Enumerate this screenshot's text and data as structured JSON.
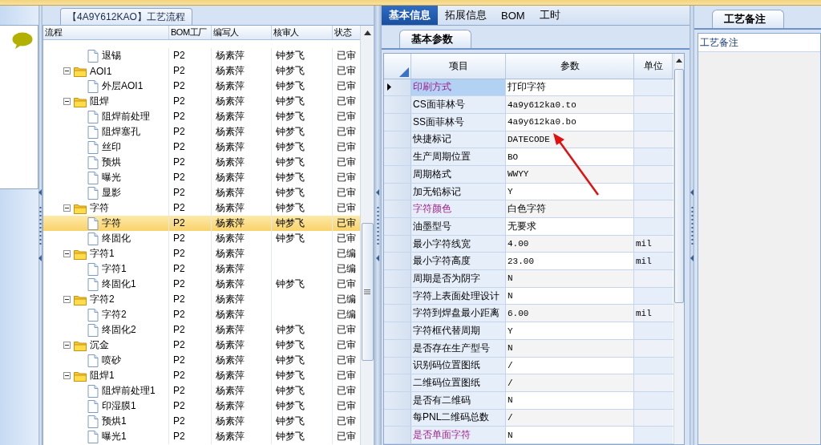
{
  "process_panel": {
    "title": "【4A9Y612KAO】工艺流程",
    "columns": [
      "流程",
      "BOM工厂",
      "编写人",
      "核审人",
      "状态"
    ],
    "tree": [
      {
        "kind": "step",
        "name": "退锡",
        "bom": "P2",
        "writer": "杨素萍",
        "reviewer": "钟梦飞",
        "status": "已审",
        "selected": false
      },
      {
        "kind": "folder",
        "name": "AOI1",
        "bom": "P2",
        "writer": "杨素萍",
        "reviewer": "钟梦飞",
        "status": "已审",
        "selected": false,
        "expanded": true,
        "children": [
          {
            "kind": "step",
            "name": "外层AOI1",
            "bom": "P2",
            "writer": "杨素萍",
            "reviewer": "钟梦飞",
            "status": "已审",
            "selected": false
          }
        ]
      },
      {
        "kind": "folder",
        "name": "阻焊",
        "bom": "P2",
        "writer": "杨素萍",
        "reviewer": "钟梦飞",
        "status": "已审",
        "selected": false,
        "expanded": true,
        "children": [
          {
            "kind": "step",
            "name": "阻焊前处理",
            "bom": "P2",
            "writer": "杨素萍",
            "reviewer": "钟梦飞",
            "status": "已审",
            "selected": false
          },
          {
            "kind": "step",
            "name": "阻焊塞孔",
            "bom": "P2",
            "writer": "杨素萍",
            "reviewer": "钟梦飞",
            "status": "已审",
            "selected": false
          },
          {
            "kind": "step",
            "name": "丝印",
            "bom": "P2",
            "writer": "杨素萍",
            "reviewer": "钟梦飞",
            "status": "已审",
            "selected": false
          },
          {
            "kind": "step",
            "name": "预烘",
            "bom": "P2",
            "writer": "杨素萍",
            "reviewer": "钟梦飞",
            "status": "已审",
            "selected": false
          },
          {
            "kind": "step",
            "name": "曝光",
            "bom": "P2",
            "writer": "杨素萍",
            "reviewer": "钟梦飞",
            "status": "已审",
            "selected": false
          },
          {
            "kind": "step",
            "name": "显影",
            "bom": "P2",
            "writer": "杨素萍",
            "reviewer": "钟梦飞",
            "status": "已审",
            "selected": false
          }
        ]
      },
      {
        "kind": "folder",
        "name": "字符",
        "bom": "P2",
        "writer": "杨素萍",
        "reviewer": "钟梦飞",
        "status": "已审",
        "selected": false,
        "expanded": true,
        "children": [
          {
            "kind": "step",
            "name": "字符",
            "bom": "P2",
            "writer": "杨素萍",
            "reviewer": "钟梦飞",
            "status": "已审",
            "selected": true
          },
          {
            "kind": "step",
            "name": "终固化",
            "bom": "P2",
            "writer": "杨素萍",
            "reviewer": "钟梦飞",
            "status": "已审",
            "selected": false
          }
        ]
      },
      {
        "kind": "folder",
        "name": "字符1",
        "bom": "P2",
        "writer": "杨素萍",
        "status": "已编",
        "selected": false,
        "expanded": true,
        "children": [
          {
            "kind": "step",
            "name": "字符1",
            "bom": "P2",
            "writer": "杨素萍",
            "status": "已编",
            "selected": false
          },
          {
            "kind": "step",
            "name": "终固化1",
            "bom": "P2",
            "writer": "杨素萍",
            "reviewer": "钟梦飞",
            "status": "已审",
            "selected": false
          }
        ]
      },
      {
        "kind": "folder",
        "name": "字符2",
        "bom": "P2",
        "writer": "杨素萍",
        "status": "已编",
        "selected": false,
        "expanded": true,
        "children": [
          {
            "kind": "step",
            "name": "字符2",
            "bom": "P2",
            "writer": "杨素萍",
            "status": "已编",
            "selected": false
          },
          {
            "kind": "step",
            "name": "终固化2",
            "bom": "P2",
            "writer": "杨素萍",
            "reviewer": "钟梦飞",
            "status": "已审",
            "selected": false
          }
        ]
      },
      {
        "kind": "folder",
        "name": "沉金",
        "bom": "P2",
        "writer": "杨素萍",
        "reviewer": "钟梦飞",
        "status": "已审",
        "selected": false,
        "expanded": true,
        "children": [
          {
            "kind": "step",
            "name": "喷砂",
            "bom": "P2",
            "writer": "杨素萍",
            "reviewer": "钟梦飞",
            "status": "已审",
            "selected": false
          }
        ]
      },
      {
        "kind": "folder",
        "name": "阻焊1",
        "bom": "P2",
        "writer": "杨素萍",
        "reviewer": "钟梦飞",
        "status": "已审",
        "selected": false,
        "expanded": true,
        "children": [
          {
            "kind": "step",
            "name": "阻焊前处理1",
            "bom": "P2",
            "writer": "杨素萍",
            "reviewer": "钟梦飞",
            "status": "已审",
            "selected": false
          },
          {
            "kind": "step",
            "name": "印湿膜1",
            "bom": "P2",
            "writer": "杨素萍",
            "reviewer": "钟梦飞",
            "status": "已审",
            "selected": false
          },
          {
            "kind": "step",
            "name": "预烘1",
            "bom": "P2",
            "writer": "杨素萍",
            "reviewer": "钟梦飞",
            "status": "已审",
            "selected": false
          },
          {
            "kind": "step",
            "name": "曝光1",
            "bom": "P2",
            "writer": "杨素萍",
            "reviewer": "钟梦飞",
            "status": "已审",
            "selected": false
          }
        ]
      }
    ]
  },
  "detail_panel": {
    "tabs": [
      {
        "label": "基本信息",
        "selected": true
      },
      {
        "label": "拓展信息",
        "selected": false
      },
      {
        "label": "BOM",
        "selected": false
      },
      {
        "label": "工时",
        "selected": false
      }
    ],
    "subtab": "基本参数",
    "columns": [
      "项目",
      "参数",
      "单位"
    ],
    "rows": [
      {
        "item": "印刷方式",
        "value": "打印字符",
        "emphasis": true,
        "selected": true
      },
      {
        "item": "CS面菲林号",
        "value": "4a9y612ka0.to",
        "emphasis": false,
        "selected": false
      },
      {
        "item": "SS面菲林号",
        "value": "4a9y612ka0.bo",
        "emphasis": false,
        "selected": false
      },
      {
        "item": "快捷标记",
        "value": "DATECODE",
        "emphasis": false,
        "selected": false
      },
      {
        "item": "生产周期位置",
        "value": "BO",
        "emphasis": false,
        "selected": false
      },
      {
        "item": "周期格式",
        "value": "WWYY",
        "emphasis": false,
        "selected": false
      },
      {
        "item": "加无铅标记",
        "value": "Y",
        "emphasis": false,
        "selected": false
      },
      {
        "item": "字符颜色",
        "value": "白色字符",
        "emphasis": true,
        "selected": false
      },
      {
        "item": "油墨型号",
        "value": "无要求",
        "emphasis": false,
        "selected": false
      },
      {
        "item": "最小字符线宽",
        "value": "4.00",
        "unit": "mil",
        "emphasis": false,
        "selected": false
      },
      {
        "item": "最小字符高度",
        "value": "23.00",
        "unit": "mil",
        "emphasis": false,
        "selected": false
      },
      {
        "item": "周期是否为阴字",
        "value": "N",
        "emphasis": false,
        "selected": false
      },
      {
        "item": "字符上表面处理设计",
        "value": "N",
        "emphasis": false,
        "selected": false
      },
      {
        "item": "字符到焊盘最小距离",
        "value": "6.00",
        "unit": "mil",
        "emphasis": false,
        "selected": false
      },
      {
        "item": "字符框代替周期",
        "value": "Y",
        "emphasis": false,
        "selected": false
      },
      {
        "item": "是否存在生产型号",
        "value": "N",
        "emphasis": false,
        "selected": false
      },
      {
        "item": "识别码位置图纸",
        "value": "/",
        "emphasis": false,
        "selected": false
      },
      {
        "item": "二维码位置图纸",
        "value": "/",
        "emphasis": false,
        "selected": false
      },
      {
        "item": "是否有二维码",
        "value": "N",
        "emphasis": false,
        "selected": false
      },
      {
        "item": "每PNL二维码总数",
        "value": "/",
        "emphasis": false,
        "selected": false
      },
      {
        "item": "是否单面字符",
        "value": "N",
        "emphasis": true,
        "selected": false
      }
    ]
  },
  "notes_panel": {
    "tab": "工艺备注",
    "header": "工艺备注"
  }
}
